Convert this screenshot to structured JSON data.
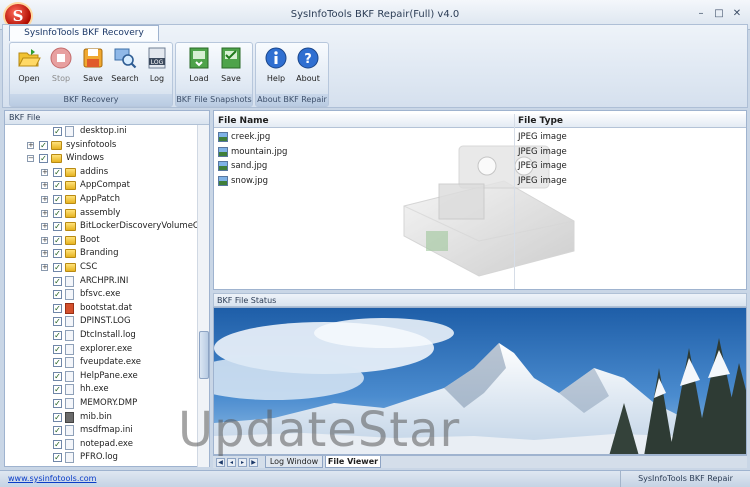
{
  "titlebar": {
    "logo_text": "S",
    "title": "SysInfoTools BKF Repair(Full) v4.0",
    "minimize": "–",
    "maximize": "□",
    "close": "✕"
  },
  "ribbon": {
    "tab_label": "SysInfoTools BKF Recovery",
    "groups": [
      {
        "caption": "BKF Recovery",
        "tools": [
          "Open",
          "Stop",
          "Save",
          "Search",
          "Log"
        ]
      },
      {
        "caption": "BKF File Snapshots",
        "tools": [
          "Load",
          "Save"
        ]
      },
      {
        "caption": "About BKF Repair",
        "tools": [
          "Help",
          "About"
        ]
      }
    ]
  },
  "left_pane": {
    "header": "BKF File",
    "tree": [
      "desktop.ini",
      "sysinfotools",
      "Windows",
      "addins",
      "AppCompat",
      "AppPatch",
      "assembly",
      "BitLockerDiscoveryVolumeCor",
      "Boot",
      "Branding",
      "CSC",
      "ARCHPR.INI",
      "bfsvc.exe",
      "bootstat.dat",
      "DPINST.LOG",
      "DtcInstall.log",
      "explorer.exe",
      "fveupdate.exe",
      "HelpPane.exe",
      "hh.exe",
      "MEMORY.DMP",
      "mib.bin",
      "msdfmap.ini",
      "notepad.exe",
      "PFRO.log"
    ]
  },
  "file_list": {
    "headers": [
      "File Name",
      "File Type"
    ],
    "rows": [
      {
        "name": "creek.jpg",
        "type": "JPEG image"
      },
      {
        "name": "mountain.jpg",
        "type": "JPEG image"
      },
      {
        "name": "sand.jpg",
        "type": "JPEG image"
      },
      {
        "name": "snow.jpg",
        "type": "JPEG image"
      }
    ]
  },
  "status": {
    "header": "BKF File Status"
  },
  "bottom_tabs": {
    "nav": [
      "◀",
      "◂",
      "▸",
      "▶"
    ],
    "tabs": [
      "Log Window",
      "File Viewer"
    ],
    "active": "File Viewer"
  },
  "statusbar": {
    "link": "www.sysinfotools.com",
    "right": "SysInfoTools BKF Repair"
  },
  "watermark": "UpdateStar"
}
